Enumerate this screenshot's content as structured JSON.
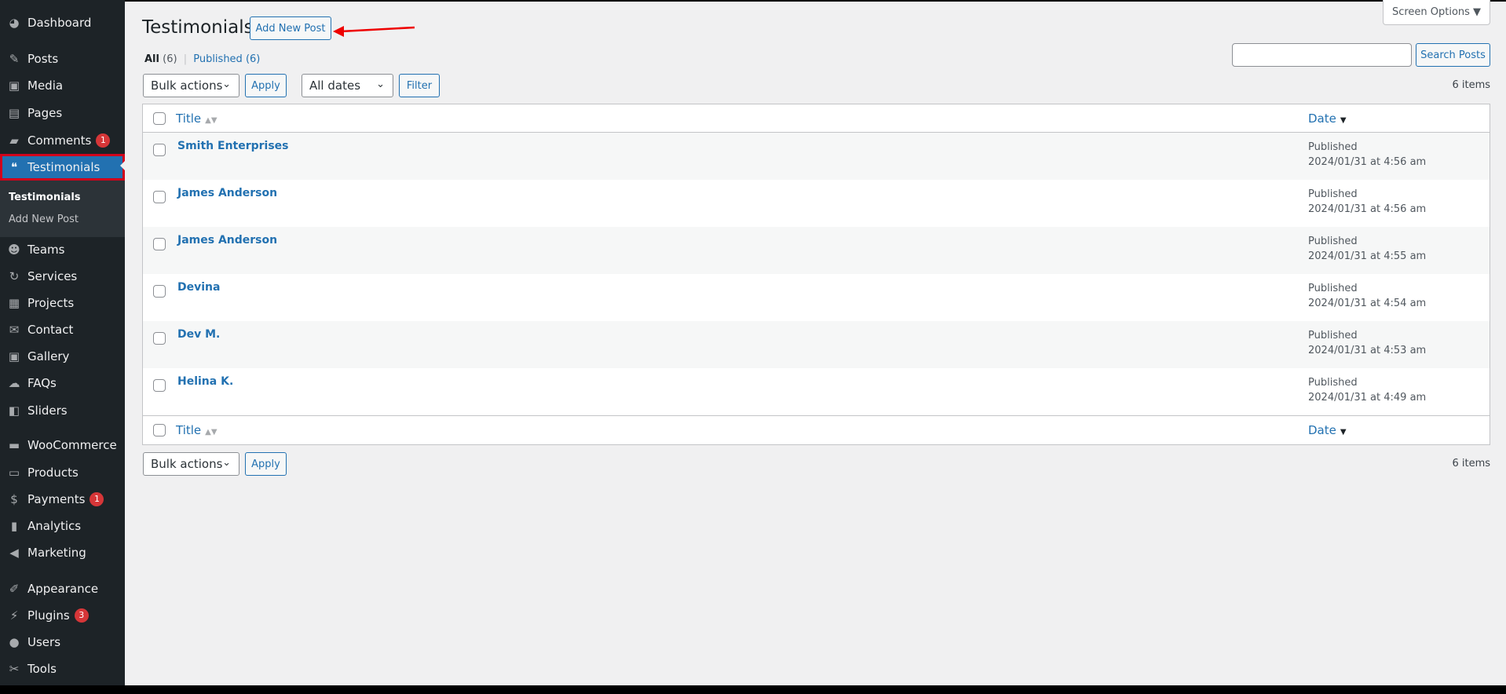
{
  "sidebar": {
    "items": [
      {
        "label": "Dashboard",
        "icon": "dashboard-icon",
        "glyph": "◕"
      },
      {
        "label": "Posts",
        "icon": "pin-icon",
        "glyph": "✎"
      },
      {
        "label": "Media",
        "icon": "media-icon",
        "glyph": "▣"
      },
      {
        "label": "Pages",
        "icon": "pages-icon",
        "glyph": "▤"
      },
      {
        "label": "Comments",
        "icon": "comment-icon",
        "glyph": "▰",
        "badge": "1"
      },
      {
        "label": "Testimonials",
        "icon": "testimonial-icon",
        "glyph": "❝",
        "current": true
      },
      {
        "label": "Teams",
        "icon": "groups-icon",
        "glyph": "☻"
      },
      {
        "label": "Services",
        "icon": "update-icon",
        "glyph": "↻"
      },
      {
        "label": "Projects",
        "icon": "portfolio-icon",
        "glyph": "▦"
      },
      {
        "label": "Contact",
        "icon": "email-icon",
        "glyph": "✉"
      },
      {
        "label": "Gallery",
        "icon": "gallery-icon",
        "glyph": "▣"
      },
      {
        "label": "FAQs",
        "icon": "chat-icon",
        "glyph": "☁"
      },
      {
        "label": "Sliders",
        "icon": "slides-icon",
        "glyph": "◧"
      },
      {
        "label": "WooCommerce",
        "icon": "woo-icon",
        "glyph": "▬"
      },
      {
        "label": "Products",
        "icon": "archive-icon",
        "glyph": "▭"
      },
      {
        "label": "Payments",
        "icon": "payment-icon",
        "glyph": "$",
        "badge": "1"
      },
      {
        "label": "Analytics",
        "icon": "chart-icon",
        "glyph": "▮"
      },
      {
        "label": "Marketing",
        "icon": "megaphone-icon",
        "glyph": "◀"
      },
      {
        "label": "Appearance",
        "icon": "brush-icon",
        "glyph": "✐"
      },
      {
        "label": "Plugins",
        "icon": "plugin-icon",
        "glyph": "⚡",
        "badge": "3"
      },
      {
        "label": "Users",
        "icon": "user-icon",
        "glyph": "●"
      },
      {
        "label": "Tools",
        "icon": "wrench-icon",
        "glyph": "✂"
      }
    ],
    "submenu": [
      "Testimonials",
      "Add New Post"
    ]
  },
  "header": {
    "title": "Testimonials",
    "add_new": "Add New Post",
    "screen_options": "Screen Options ▼"
  },
  "filters": {
    "all": "All",
    "all_count": "(6)",
    "published": "Published (6)",
    "search_button": "Search Posts",
    "search_value": "",
    "bulk": "Bulk actions",
    "apply": "Apply",
    "dates": "All dates",
    "filter": "Filter",
    "items": "6 items"
  },
  "table": {
    "col_title": "Title",
    "col_date": "Date",
    "rows": [
      {
        "title": "Smith Enterprises",
        "status": "Published",
        "date": "2024/01/31 at 4:56 am"
      },
      {
        "title": "James Anderson",
        "status": "Published",
        "date": "2024/01/31 at 4:56 am"
      },
      {
        "title": "James Anderson",
        "status": "Published",
        "date": "2024/01/31 at 4:55 am"
      },
      {
        "title": "Devina",
        "status": "Published",
        "date": "2024/01/31 at 4:54 am"
      },
      {
        "title": "Dev M.",
        "status": "Published",
        "date": "2024/01/31 at 4:53 am"
      },
      {
        "title": "Helina K.",
        "status": "Published",
        "date": "2024/01/31 at 4:49 am"
      }
    ]
  },
  "colors": {
    "accent": "#2271b1",
    "sidebar": "#1d2327",
    "highlight": "#d0021b"
  }
}
